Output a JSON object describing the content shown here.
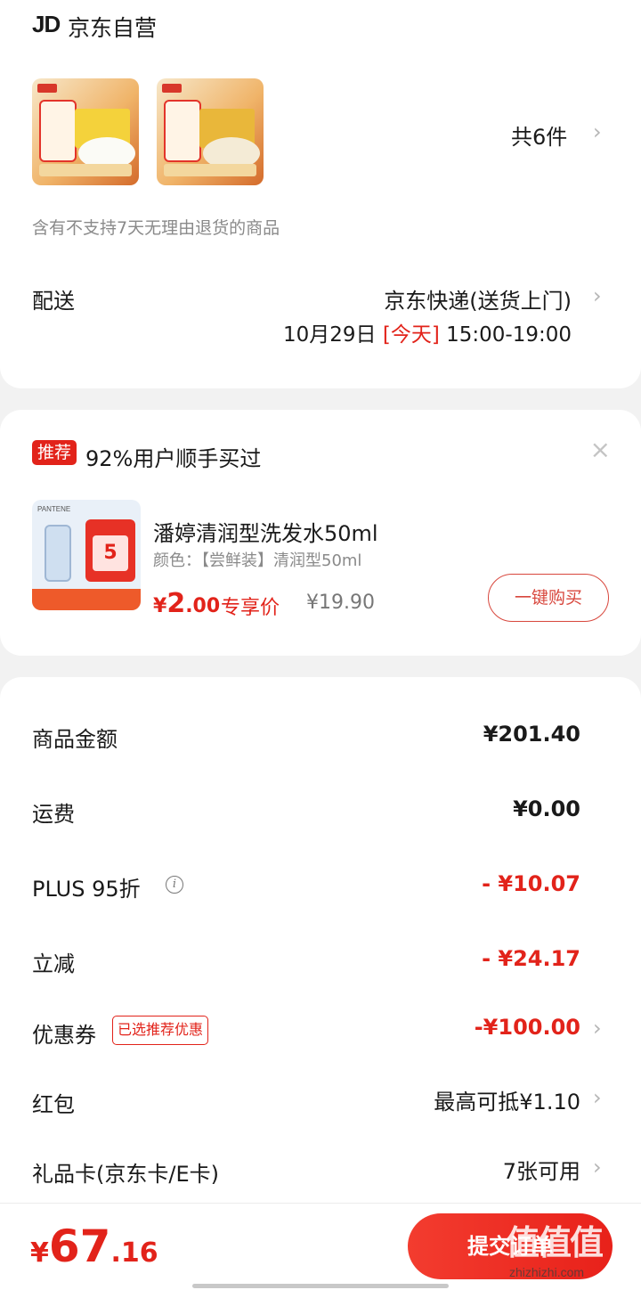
{
  "store": {
    "logo": "JD",
    "name": "京东自营"
  },
  "order_items": {
    "count_label": "共6件",
    "return_note": "含有不支持7天无理由退货的商品"
  },
  "shipping": {
    "label": "配送",
    "method": "京东快递(送货上门)",
    "date": "10月29日",
    "today": "[今天]",
    "time": "15:00-19:00"
  },
  "recommend": {
    "badge": "推荐",
    "text": "92%用户顺手买过",
    "product": {
      "name": "潘婷清润型洗发水50ml",
      "spec": "颜色：【尝鲜装】清润型50ml",
      "price_symbol": "¥",
      "price_int": "2",
      "price_dec": ".00",
      "price_tag": "专享价",
      "original_price": "¥19.90",
      "buy_label": "一键购买",
      "image_brand": "PANTENE",
      "image_coupon_num": "5"
    }
  },
  "summary": {
    "goods_label": "商品金额",
    "goods_value": "¥201.40",
    "freight_label": "运费",
    "freight_value": "¥0.00",
    "plus_label": "PLUS 95折",
    "plus_value": "- ¥10.07",
    "instant_label": "立减",
    "instant_value": "- ¥24.17",
    "coupon_label": "优惠券",
    "coupon_tag": "已选推荐优惠",
    "coupon_value": "-¥100.00",
    "redpacket_label": "红包",
    "redpacket_value": "最高可抵¥1.10",
    "giftcard_label": "礼品卡(京东卡/E卡)",
    "giftcard_value": "7张可用"
  },
  "footer": {
    "total_symbol": "¥",
    "total_int": "67",
    "total_dec": ".16",
    "submit_label": "提交订单",
    "watermark": "值值值",
    "watermark_url": "zhizhizhi.com"
  },
  "colors": {
    "accent": "#e2231a",
    "background": "#f2f2f2",
    "card": "#ffffff"
  }
}
